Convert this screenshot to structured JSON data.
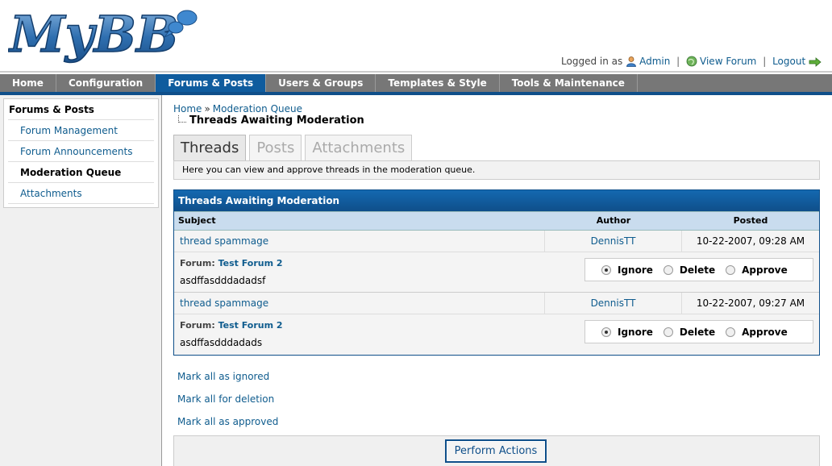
{
  "header": {
    "logo_text": "MyBB",
    "userbar": {
      "logged_in_as": "Logged in as",
      "user": "Admin",
      "view_forum": "View Forum",
      "logout": "Logout"
    }
  },
  "nav": {
    "items": [
      "Home",
      "Configuration",
      "Forums & Posts",
      "Users & Groups",
      "Templates & Style",
      "Tools & Maintenance"
    ],
    "active": "Forums & Posts"
  },
  "sidebar": {
    "title": "Forums & Posts",
    "items": [
      "Forum Management",
      "Forum Announcements",
      "Moderation Queue",
      "Attachments"
    ],
    "current": "Moderation Queue"
  },
  "breadcrumb": {
    "home": "Home",
    "separator": "»",
    "current": "Moderation Queue"
  },
  "page_title": "Threads Awaiting Moderation",
  "tabs": [
    {
      "label": "Threads",
      "active": true
    },
    {
      "label": "Posts",
      "active": false
    },
    {
      "label": "Attachments",
      "active": false
    }
  ],
  "tab_description": "Here you can view and approve threads in the moderation queue.",
  "table": {
    "title": "Threads Awaiting Moderation",
    "columns": [
      "Subject",
      "Author",
      "Posted"
    ],
    "forum_label": "Forum:",
    "action_labels": [
      "Ignore",
      "Delete",
      "Approve"
    ],
    "rows": [
      {
        "subject": "thread spammage",
        "author": "DennisTT",
        "posted": "10-22-2007, 09:28 AM",
        "forum": "Test Forum 2",
        "body": "asdffasdddadadsf",
        "selected_action": "Ignore"
      },
      {
        "subject": "thread spammage",
        "author": "DennisTT",
        "posted": "10-22-2007, 09:27 AM",
        "forum": "Test Forum 2",
        "body": "asdffasdddadads",
        "selected_action": "Ignore"
      }
    ]
  },
  "mark_links": [
    "Mark all as ignored",
    "Mark all for deletion",
    "Mark all as approved"
  ],
  "submit": {
    "label": "Perform Actions"
  },
  "colors": {
    "nav_bg": "#777777",
    "nav_active": "#0f5c9e",
    "table_header": "#0f4f8a",
    "column_header": "#c9dcee",
    "link": "#0f5c8e"
  }
}
